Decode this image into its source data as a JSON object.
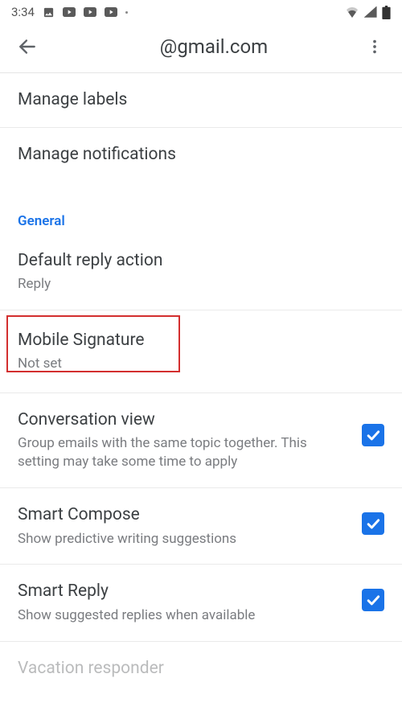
{
  "status": {
    "time": "3:34"
  },
  "header": {
    "title": "@gmail.com"
  },
  "rows": {
    "manage_labels": "Manage labels",
    "manage_notifications": "Manage notifications"
  },
  "section": {
    "general": "General"
  },
  "default_reply": {
    "title": "Default reply action",
    "value": "Reply"
  },
  "signature": {
    "title": "Mobile Signature",
    "value": "Not set"
  },
  "conversation": {
    "title": "Conversation view",
    "sub": "Group emails with the same topic together. This setting may take some time to apply"
  },
  "smart_compose": {
    "title": "Smart Compose",
    "sub": "Show predictive writing suggestions"
  },
  "smart_reply": {
    "title": "Smart Reply",
    "sub": "Show suggested replies when available"
  },
  "vacation": {
    "title": "Vacation responder"
  }
}
